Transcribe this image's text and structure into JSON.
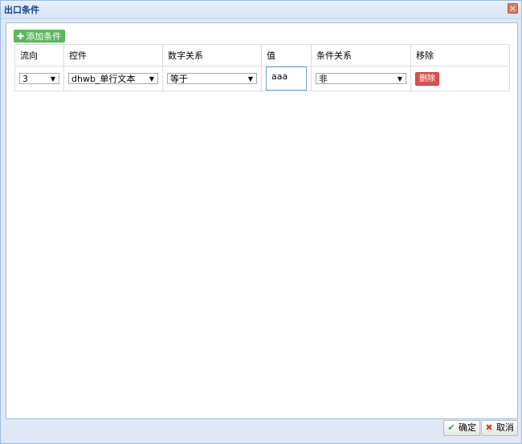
{
  "window": {
    "title": "出口条件",
    "close_glyph": "×"
  },
  "toolbar": {
    "add_label": "添加条件",
    "add_icon": "plus-icon"
  },
  "table": {
    "headers": [
      "流向",
      "控件",
      "数字关系",
      "值",
      "条件关系",
      "移除"
    ],
    "rows": [
      {
        "direction": "3",
        "control": "dhwb_单行文本",
        "relation": "等于",
        "value": "aaa",
        "logic": "非",
        "remove_label": "删除"
      }
    ]
  },
  "footer": {
    "ok_label": "确定",
    "cancel_label": "取消"
  },
  "colors": {
    "add_button": "#5cb85c",
    "delete_button": "#d9534f",
    "title_text": "#15428b"
  }
}
